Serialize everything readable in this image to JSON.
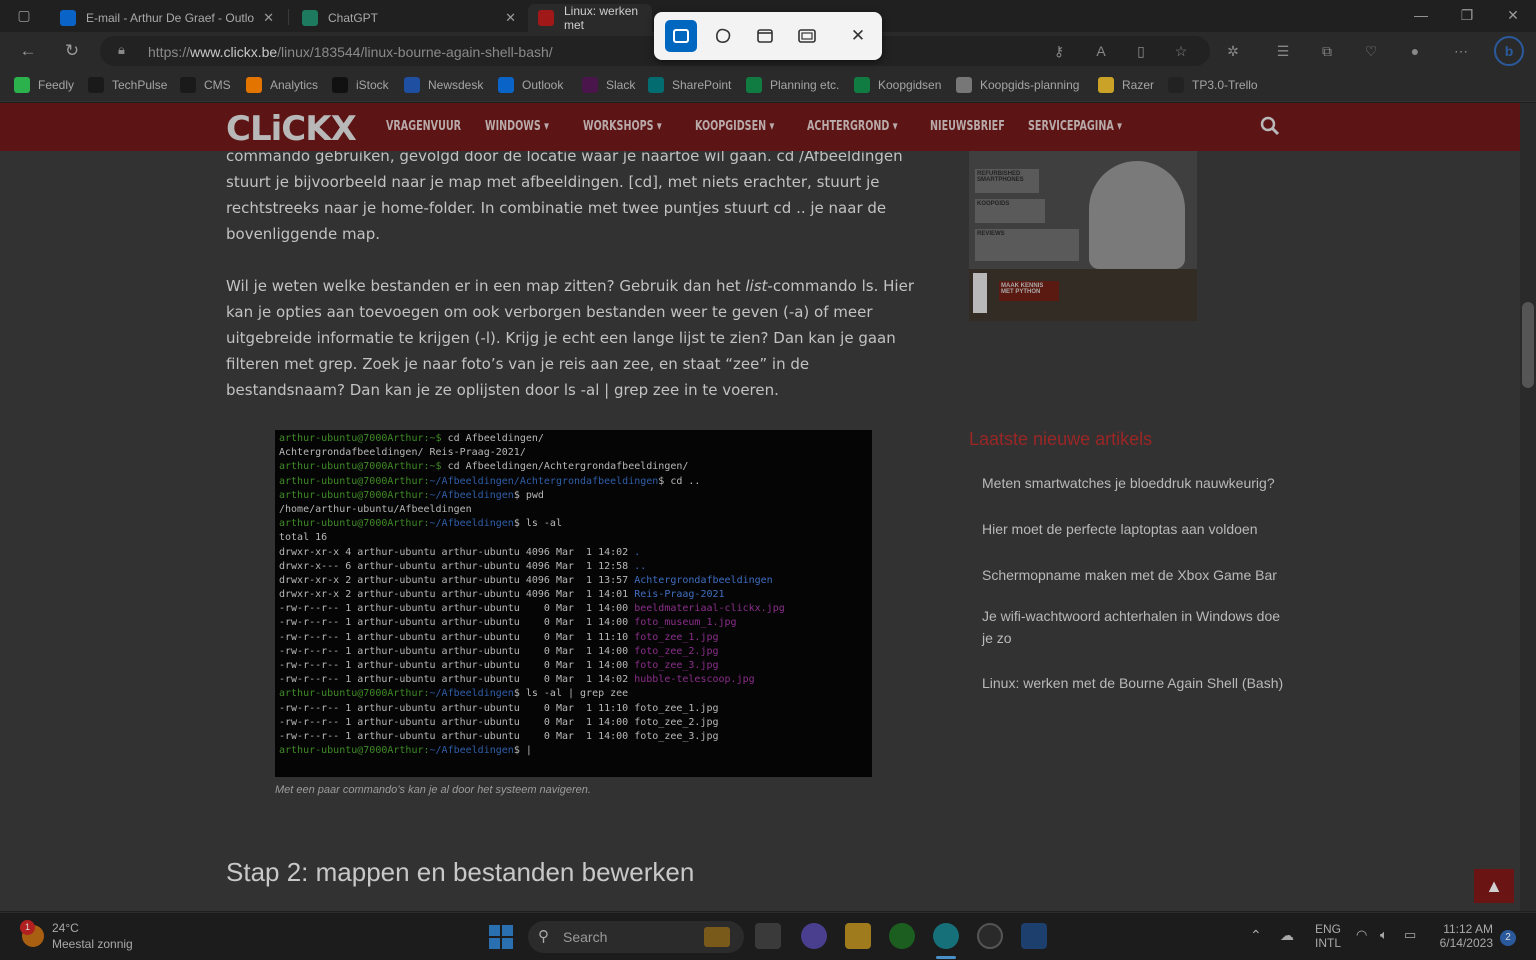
{
  "tabs": [
    {
      "label": "E-mail - Arthur De Graef - Outlo",
      "close": "✕"
    },
    {
      "label": "ChatGPT",
      "close": "✕"
    },
    {
      "label": "Linux: werken met"
    }
  ],
  "window_controls": {
    "minimize": "—",
    "restore": "❐",
    "close": "✕"
  },
  "address": {
    "url_prefix": "https://",
    "url_domain": "www.clickx.be",
    "url_path": "/linux/183544/linux-bourne-again-shell-bash/"
  },
  "bookmarks": [
    {
      "label": "Feedly",
      "color": "#2bb24c"
    },
    {
      "label": "TechPulse",
      "color": "#1a1a1a"
    },
    {
      "label": "CMS",
      "color": "#1a1a1a"
    },
    {
      "label": "Analytics",
      "color": "#e37400"
    },
    {
      "label": "iStock",
      "color": "#111111"
    },
    {
      "label": "Newsdesk",
      "color": "#1e4fa0"
    },
    {
      "label": "Outlook",
      "color": "#0a64c8"
    },
    {
      "label": "Slack",
      "color": "#4a154b"
    },
    {
      "label": "SharePoint",
      "color": "#036c70"
    },
    {
      "label": "Planning etc.",
      "color": "#107c41"
    },
    {
      "label": "Koopgidsen",
      "color": "#107c41"
    },
    {
      "label": "Koopgids-planning",
      "color": "#777777"
    },
    {
      "label": "Razer",
      "color": "#c9a227"
    },
    {
      "label": "TP3.0-Trello",
      "color": "#222222"
    }
  ],
  "site": {
    "logo": "CLiCKX",
    "menu": [
      "VRAGENVUUR",
      "WINDOWS ▾",
      "WORKSHOPS ▾",
      "KOOPGIDSEN ▾",
      "ACHTERGROND ▾",
      "NIEUWSBRIEF",
      "SERVICEPAGINA ▾"
    ]
  },
  "article": {
    "para1": "commando gebruiken, gevolgd door de locatie waar je naartoe wil gaan. cd /Afbeeldingen stuurt je bijvoorbeeld naar je map met afbeeldingen. [cd], met niets erachter, stuurt je rechtstreeks naar je home-folder. In combinatie met twee puntjes stuurt cd .. je naar de bovenliggende map.",
    "para2_a": "Wil je weten welke bestanden er in een map zitten? Gebruik dan het ",
    "para2_em": "list",
    "para2_b": "-commando ls. Hier kan je opties aan toevoegen om ook verborgen bestanden weer te geven (-a) of meer uitgebreide informatie te krijgen (-l). Krijg je echt een lange lijst te zien? Dan kan je gaan filteren met grep. Zoek je naar foto’s van je reis aan zee, en staat “zee” in de bestandsnaam? Dan kan je ze oplijsten door ls -al | grep zee in te voeren.",
    "caption": "Met een paar commando’s kan je al door het systeem navigeren.",
    "heading": "Stap 2: mappen en bestanden bewerken"
  },
  "terminal": [
    [
      {
        "t": "arthur-ubuntu@7000Arthur:~$ ",
        "c": "prompt"
      },
      {
        "t": "cd Afbeeldingen/"
      }
    ],
    [
      {
        "t": "Achtergrondafbeeldingen/ Reis-Praag-2021/"
      }
    ],
    [
      {
        "t": "arthur-ubuntu@7000Arthur:~$ ",
        "c": "prompt"
      },
      {
        "t": "cd Afbeeldingen/Achtergrondafbeeldingen/"
      }
    ],
    [
      {
        "t": "arthur-ubuntu@7000Arthur:",
        "c": "prompt"
      },
      {
        "t": "~/Afbeeldingen/Achtergrondafbeeldingen",
        "c": "path"
      },
      {
        "t": "$ cd .."
      }
    ],
    [
      {
        "t": "arthur-ubuntu@7000Arthur:",
        "c": "prompt"
      },
      {
        "t": "~/Afbeeldingen",
        "c": "path"
      },
      {
        "t": "$ pwd"
      }
    ],
    [
      {
        "t": "/home/arthur-ubuntu/Afbeeldingen"
      }
    ],
    [
      {
        "t": "arthur-ubuntu@7000Arthur:",
        "c": "prompt"
      },
      {
        "t": "~/Afbeeldingen",
        "c": "path"
      },
      {
        "t": "$ ls -al"
      }
    ],
    [
      {
        "t": "total 16"
      }
    ],
    [
      {
        "t": "drwxr-xr-x 4 arthur-ubuntu arthur-ubuntu 4096 Mar  1 14:02 "
      },
      {
        "t": ".",
        "c": "dir"
      }
    ],
    [
      {
        "t": "drwxr-x--- 6 arthur-ubuntu arthur-ubuntu 4096 Mar  1 12:58 "
      },
      {
        "t": "..",
        "c": "dir"
      }
    ],
    [
      {
        "t": "drwxr-xr-x 2 arthur-ubuntu arthur-ubuntu 4096 Mar  1 13:57 "
      },
      {
        "t": "Achtergrondafbeeldingen",
        "c": "dir"
      }
    ],
    [
      {
        "t": "drwxr-xr-x 2 arthur-ubuntu arthur-ubuntu 4096 Mar  1 14:01 "
      },
      {
        "t": "Reis-Praag-2021",
        "c": "dir"
      }
    ],
    [
      {
        "t": "-rw-r--r-- 1 arthur-ubuntu arthur-ubuntu    0 Mar  1 14:00 "
      },
      {
        "t": "beeldmateriaal-clickx.jpg",
        "c": "img"
      }
    ],
    [
      {
        "t": "-rw-r--r-- 1 arthur-ubuntu arthur-ubuntu    0 Mar  1 14:00 "
      },
      {
        "t": "foto_museum_1.jpg",
        "c": "img"
      }
    ],
    [
      {
        "t": "-rw-r--r-- 1 arthur-ubuntu arthur-ubuntu    0 Mar  1 11:10 "
      },
      {
        "t": "foto_zee_1.jpg",
        "c": "img"
      }
    ],
    [
      {
        "t": "-rw-r--r-- 1 arthur-ubuntu arthur-ubuntu    0 Mar  1 14:00 "
      },
      {
        "t": "foto_zee_2.jpg",
        "c": "img"
      }
    ],
    [
      {
        "t": "-rw-r--r-- 1 arthur-ubuntu arthur-ubuntu    0 Mar  1 14:00 "
      },
      {
        "t": "foto_zee_3.jpg",
        "c": "img"
      }
    ],
    [
      {
        "t": "-rw-r--r-- 1 arthur-ubuntu arthur-ubuntu    0 Mar  1 14:02 "
      },
      {
        "t": "hubble-telescoop.jpg",
        "c": "img"
      }
    ],
    [
      {
        "t": "arthur-ubuntu@7000Arthur:",
        "c": "prompt"
      },
      {
        "t": "~/Afbeeldingen",
        "c": "path"
      },
      {
        "t": "$ ls -al | grep zee"
      }
    ],
    [
      {
        "t": "-rw-r--r-- 1 arthur-ubuntu arthur-ubuntu    0 Mar  1 11:10 foto_zee_1.jpg"
      }
    ],
    [
      {
        "t": "-rw-r--r-- 1 arthur-ubuntu arthur-ubuntu    0 Mar  1 14:00 foto_zee_2.jpg"
      }
    ],
    [
      {
        "t": "-rw-r--r-- 1 arthur-ubuntu arthur-ubuntu    0 Mar  1 14:00 foto_zee_3.jpg"
      }
    ],
    [
      {
        "t": "arthur-ubuntu@7000Arthur:",
        "c": "prompt"
      },
      {
        "t": "~/Afbeeldingen",
        "c": "path"
      },
      {
        "t": "$ |"
      }
    ]
  ],
  "sidebar": {
    "title": "Laatste nieuwe artikels",
    "links": [
      "Meten smartwatches je bloeddruk nauwkeurig?",
      "Hier moet de perfecte laptoptas aan voldoen",
      "Schermopname maken met de Xbox Game Bar",
      "Je wifi-wachtwoord achterhalen in Windows doe je zo",
      "Linux: werken met de Bourne Again Shell (Bash)"
    ],
    "ad_lines": [
      "REFURBISHED SMARTPHONES",
      "KOOPGIDS",
      "REVIEWS",
      "MAAK KENNIS MET PYTHON"
    ]
  },
  "snip_toolbar": {
    "icons": [
      "rectangle-snip",
      "freeform-snip",
      "window-snip",
      "fullscreen-snip"
    ],
    "close": "✕"
  },
  "taskbar": {
    "weather_temp": "24°C",
    "weather_desc": "Meestal zonnig",
    "weather_badge": "1",
    "search_placeholder": "Search",
    "lang": "ENG",
    "layout": "INTL",
    "time": "11:12 AM",
    "date": "6/14/2023",
    "notif_count": "2"
  },
  "back_to_top": "▲"
}
